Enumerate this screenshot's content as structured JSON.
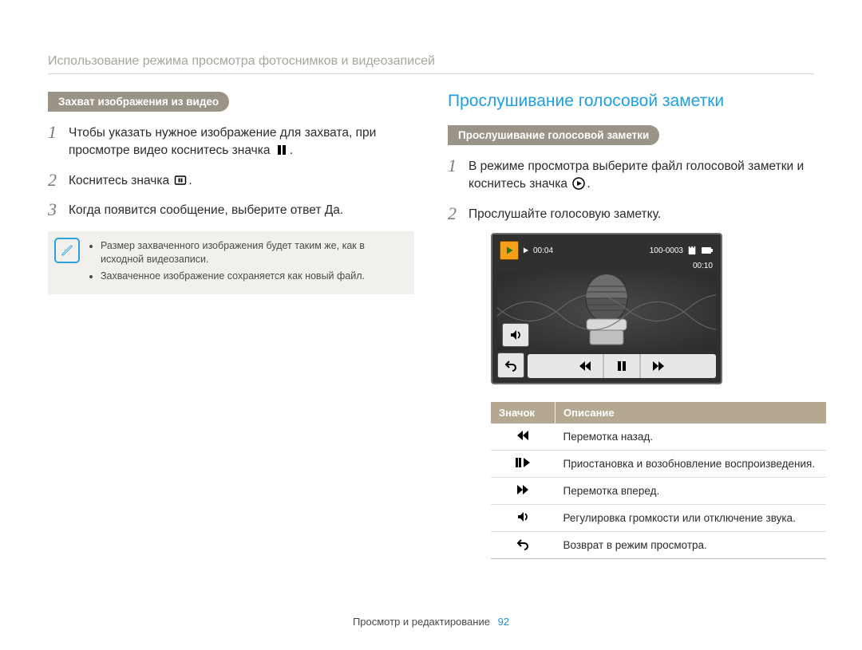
{
  "section_header": "Использование режима просмотра фотоснимков и видеозаписей",
  "left": {
    "pill": "Захват изображения из видео",
    "steps": [
      "Чтобы указать нужное изображение для захвата, при просмотре видео коснитесь значка",
      "Коснитесь значка",
      "Когда появится сообщение, выберите ответ Да."
    ],
    "note": {
      "items": [
        "Размер захваченного изображения будет таким же, как в исходной видеозаписи.",
        "Захваченное изображение сохраняется как новый файл."
      ]
    }
  },
  "right": {
    "heading": "Прослушивание голосовой заметки",
    "pill": "Прослушивание голосовой заметки",
    "steps": [
      "В режиме просмотра выберите файл голосовой заметки и коснитесь значка",
      "Прослушайте голосовую заметку."
    ],
    "player": {
      "elapsed": "00:04",
      "total": "00:10",
      "file_index": "100-0003"
    },
    "legend": {
      "col_icon": "Значок",
      "col_desc": "Описание",
      "rows": [
        {
          "icon": "rewind",
          "desc": "Перемотка назад."
        },
        {
          "icon": "pause-play",
          "desc": "Приостановка и возобновление воспроизведения."
        },
        {
          "icon": "forward",
          "desc": "Перемотка вперед."
        },
        {
          "icon": "volume",
          "desc": "Регулировка громкости или отключение звука."
        },
        {
          "icon": "back",
          "desc": "Возврат в режим просмотра."
        }
      ]
    }
  },
  "footer": {
    "label": "Просмотр и редактирование",
    "page": "92"
  }
}
